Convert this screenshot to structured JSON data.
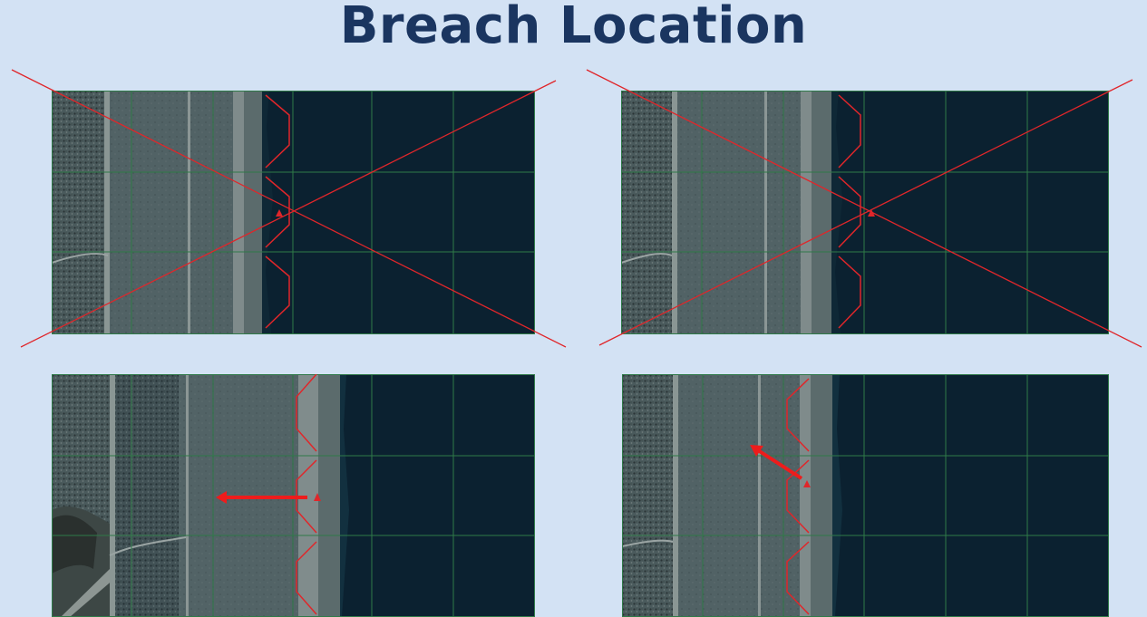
{
  "slide": {
    "title": "Breach Location"
  },
  "colors": {
    "background": "#d3e2f4",
    "title": "#1a3560",
    "water": "#0b2130",
    "grid": "#2f7a48",
    "breach_marker": "#e0262a",
    "flow_arrow": "#ee1c1c"
  },
  "panels": [
    {
      "name": "top-left",
      "marker": "breach-marker-triangle",
      "overlay": "crossed-out"
    },
    {
      "name": "top-right",
      "marker": "breach-marker-triangle",
      "overlay": "crossed-out"
    },
    {
      "name": "bottom-left",
      "marker": "breach-marker-triangle",
      "overlay": "flow-arrow-west"
    },
    {
      "name": "bottom-right",
      "marker": "breach-marker-triangle",
      "overlay": "flow-arrow-northwest"
    }
  ]
}
